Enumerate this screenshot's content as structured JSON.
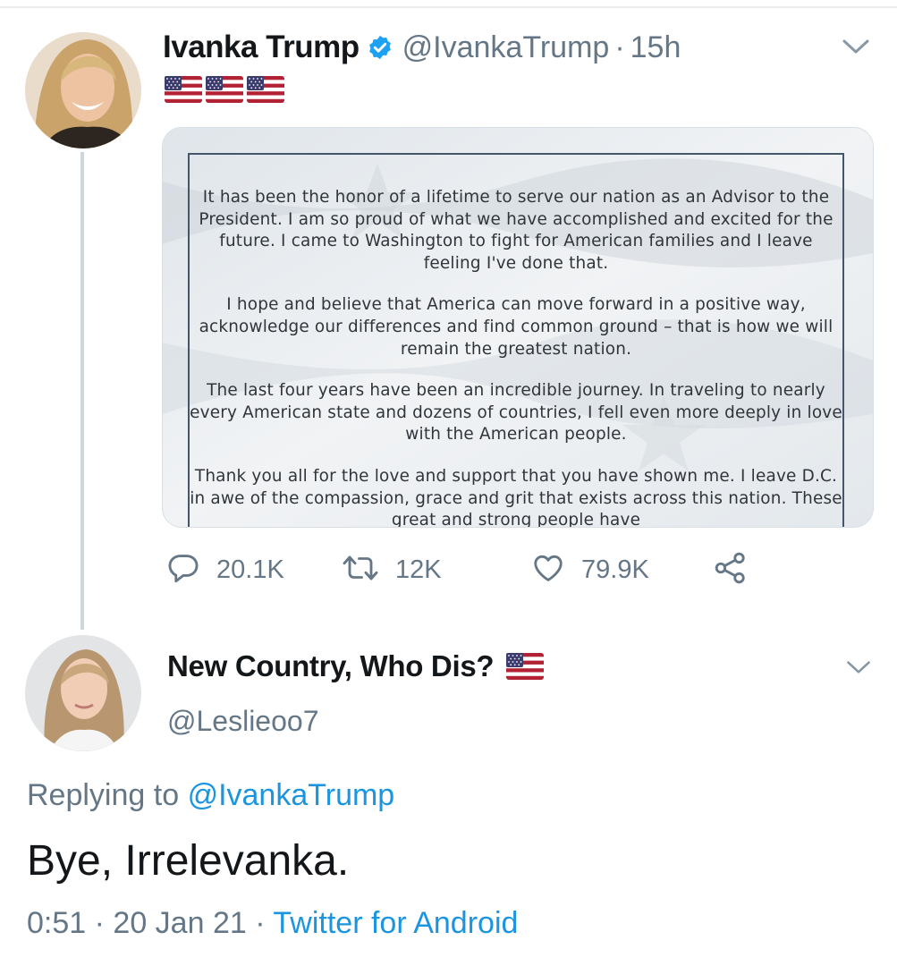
{
  "tweet": {
    "author_name": "Ivanka Trump",
    "handle": "@IvankaTrump",
    "separator": "·",
    "time": "15h",
    "text_emoji": "🇺🇸🇺🇸🇺🇸",
    "media_paragraphs": [
      "It has been the honor of a lifetime to serve our nation as an Advisor to the President. I am so proud of what we have accomplished and excited for the future. I came to Washington to fight for American families and I leave feeling I've done that.",
      "I hope and believe that America can move forward in a positive way, acknowledge our differences and find common ground – that is how we will remain the greatest nation.",
      "The last four years have been an incredible journey. In traveling to nearly every American state and dozens of countries, I fell even more deeply in love with the American people.",
      "Thank you all for the love and support that you have shown me. I leave D.C. in awe of the compassion, grace and grit that exists across this nation. These great and strong people have"
    ],
    "stats": {
      "replies": "20.1K",
      "retweets": "12K",
      "likes": "79.9K"
    }
  },
  "reply": {
    "author_name": "New Country, Who Dis?",
    "name_emoji": "🇺🇸",
    "handle": "@Leslieoo7",
    "replying_prefix": "Replying to",
    "replying_to": "@IvankaTrump",
    "text": "Bye, Irrelevanka.",
    "time": "0:51",
    "separator": "·",
    "date": "20 Jan 21",
    "source": "Twitter for Android"
  },
  "colors": {
    "primary_text": "#14171a",
    "secondary_text": "#657786",
    "link": "#1b95e0",
    "verified": "#1da1f2",
    "thread_line": "#ccd6dd"
  },
  "icons": [
    "verified-badge-icon",
    "chevron-down-icon",
    "reply-icon",
    "retweet-icon",
    "like-icon",
    "share-icon",
    "us-flag-icon"
  ]
}
